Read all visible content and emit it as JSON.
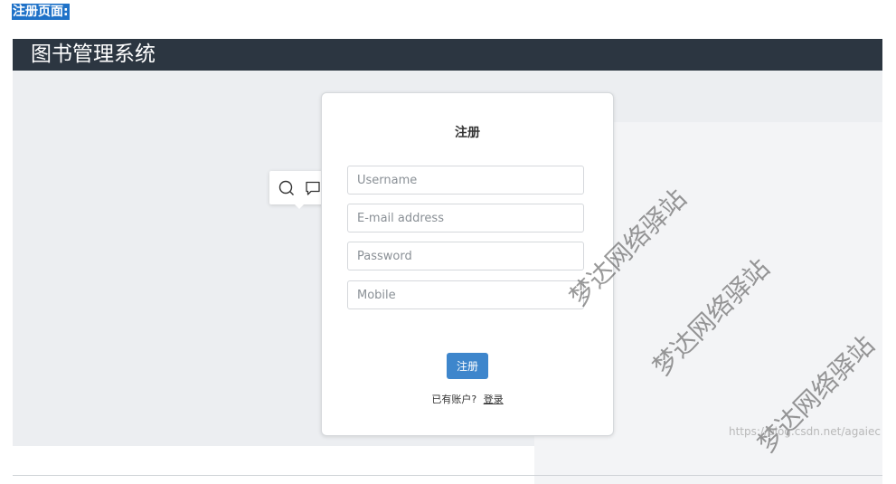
{
  "page_label": "注册页面:",
  "app": {
    "title": "图书管理系统"
  },
  "form": {
    "title": "注册",
    "username_placeholder": "Username",
    "email_placeholder": "E-mail address",
    "password_placeholder": "Password",
    "mobile_placeholder": "Mobile",
    "submit_label": "注册",
    "have_account_text": "已有账户?",
    "login_link": "登录"
  },
  "toolbar": {
    "icons": [
      "search-icon",
      "comment-icon"
    ]
  },
  "watermarks": [
    "梦达网络驿站",
    "梦达网络驿站",
    "梦达网络驿站"
  ],
  "url_watermark": "https://blog.csdn.net/agaiec",
  "colors": {
    "header_bg": "#2c3641",
    "button_bg": "#3e86cc",
    "label_bg": "#1f72c8"
  }
}
